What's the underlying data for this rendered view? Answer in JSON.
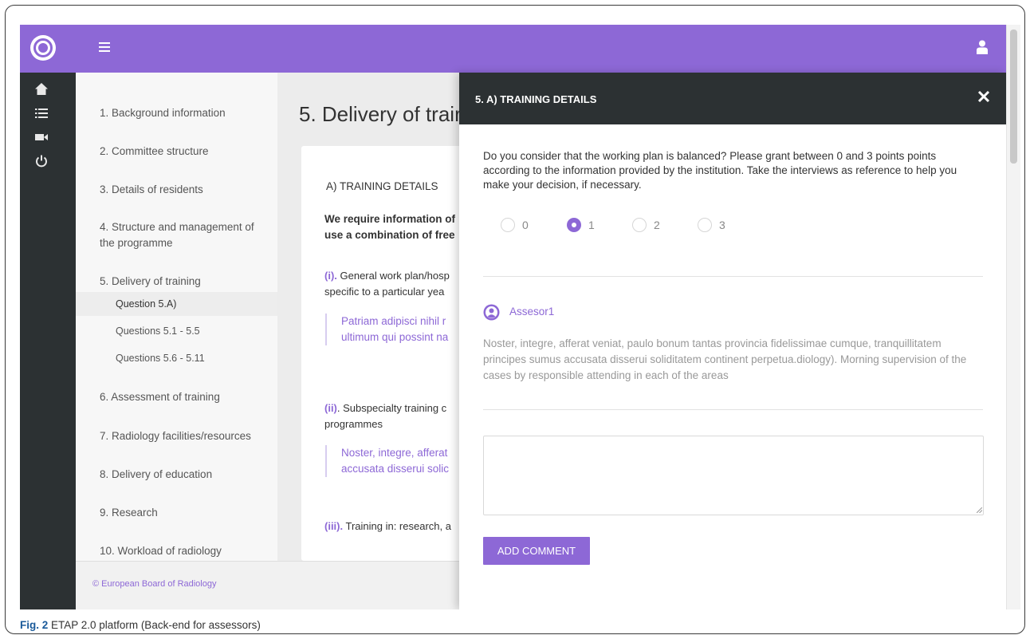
{
  "topbar": {
    "logo": "ebr-logo",
    "menu_icon": "hamburger-menu-icon",
    "user_icon": "user-icon",
    "color": "#8d68d6"
  },
  "rail": {
    "icons": [
      "home-icon",
      "list-icon",
      "video-camera-icon",
      "power-icon"
    ]
  },
  "nav": {
    "items": [
      "1. Background information",
      "2. Committee structure",
      "3. Details of residents",
      "4. Structure and management of",
      "the programme",
      "5. Delivery of training",
      "6. Assessment of training",
      "7. Radiology facilities/resources",
      "8. Delivery of education",
      "9. Research",
      "10. Workload of radiology"
    ],
    "subitems": [
      "Question 5.A)",
      "Questions 5.1 - 5.5",
      "Questions 5.6 - 5.11"
    ]
  },
  "main": {
    "title": "5. Delivery of trair",
    "section_head": "A) TRAINING DETAILS",
    "bold_line1": "We require information of",
    "bold_line2": "use a combination of free",
    "q1_marker": "(i).",
    "q1_text1": " General work plan/hosp",
    "q1_text2": "specific to a particular yea",
    "quote1_line1": "Patriam adipisci nihil r",
    "quote1_line2": "ultimum qui possint na",
    "q2_marker": "(ii)",
    "q2_text1": ". Subspecialty training c",
    "q2_text2": "programmes",
    "quote2_line1": "Noster, integre, afferat",
    "quote2_line2": "accusata disserui solic",
    "q3_marker": "(iii).",
    "q3_text1": " Training in: research, a"
  },
  "footer": {
    "text": "© European Board of Radiology"
  },
  "modal": {
    "title": "5. A) TRAINING DETAILS",
    "close_icon": "close-icon",
    "question": "Do you consider that the working plan is balanced? Please grant between 0 and 3 points points according to the information provided by the institution. Take the interviews as reference to help you make your decision, if necessary.",
    "options": [
      "0",
      "1",
      "2",
      "3"
    ],
    "selected_option": "1",
    "assessor_name": "Assesor1",
    "assessor_comment": "Noster, integre, afferat veniat, paulo bonum tantas provincia fidelissimae cumque, tranquillitatem principes sumus accusata disserui soliditatem continent perpetua.diology). Morning supervision of the cases by responsible attending in each of the areas",
    "comment_value": "",
    "add_button": "ADD COMMENT"
  },
  "caption": {
    "label": "Fig. 2",
    "text": " ETAP 2.0 platform (Back-end for assessors)"
  }
}
